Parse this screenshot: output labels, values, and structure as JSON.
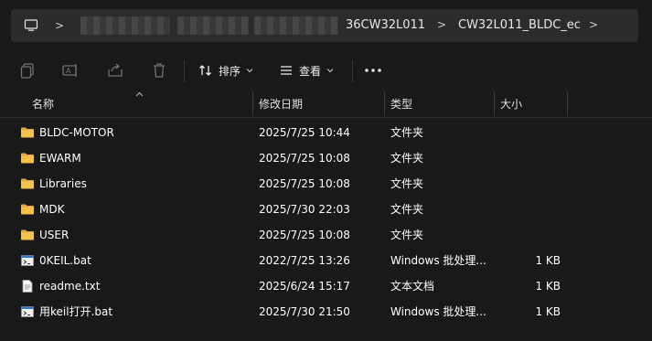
{
  "address_bar": {
    "crumbs": [
      "36CW32L011",
      "CW32L011_BLDC_ec"
    ],
    "separator": ">"
  },
  "toolbar": {
    "icons": [
      "copy-icon",
      "rename-icon",
      "share-icon",
      "delete-icon"
    ],
    "sort_label": "排序",
    "view_label": "查看",
    "more_label": "..."
  },
  "columns": {
    "name": "名称",
    "modified": "修改日期",
    "type": "类型",
    "size": "大小"
  },
  "files": [
    {
      "name": "BLDC-MOTOR",
      "modified": "2025/7/25 10:44",
      "type": "文件夹",
      "size": "",
      "icon": "folder-icon"
    },
    {
      "name": "EWARM",
      "modified": "2025/7/25 10:08",
      "type": "文件夹",
      "size": "",
      "icon": "folder-icon"
    },
    {
      "name": "Libraries",
      "modified": "2025/7/25 10:08",
      "type": "文件夹",
      "size": "",
      "icon": "folder-icon"
    },
    {
      "name": "MDK",
      "modified": "2025/7/30 22:03",
      "type": "文件夹",
      "size": "",
      "icon": "folder-icon"
    },
    {
      "name": "USER",
      "modified": "2025/7/25 10:08",
      "type": "文件夹",
      "size": "",
      "icon": "folder-icon"
    },
    {
      "name": "0KEIL.bat",
      "modified": "2022/7/25 13:26",
      "type": "Windows 批处理...",
      "size": "1 KB",
      "icon": "batch-file-icon"
    },
    {
      "name": "readme.txt",
      "modified": "2025/6/24 15:17",
      "type": "文本文档",
      "size": "1 KB",
      "icon": "text-file-icon"
    },
    {
      "name": "用keil打开.bat",
      "modified": "2025/7/30 21:50",
      "type": "Windows 批处理...",
      "size": "1 KB",
      "icon": "batch-file-icon"
    }
  ],
  "colors": {
    "background": "#191919",
    "address_bar": "#2b2b2b",
    "folder": "#f4c04e"
  }
}
